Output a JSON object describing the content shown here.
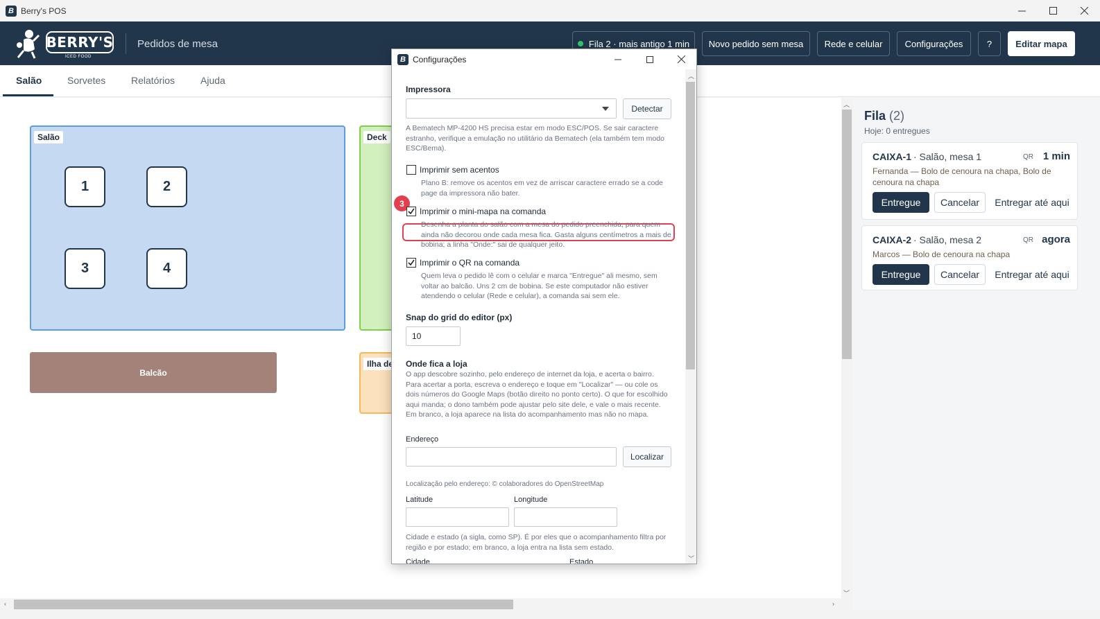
{
  "window": {
    "title": "Berry's POS",
    "app_icon": "berrys-icon",
    "minimize": "—",
    "maximize": "☐",
    "close": "✕"
  },
  "header": {
    "logo_text": "BERRY'S",
    "logo_sub": "ICED FOOD",
    "page_title": "Pedidos de mesa",
    "queue_status": "Fila 2 · mais antigo 1 min",
    "buttons": {
      "new_order": "Novo pedido sem mesa",
      "network": "Rede e celular",
      "settings": "Configurações",
      "help": "?",
      "edit_map": "Editar mapa"
    }
  },
  "tabs": [
    "Salão",
    "Sorvetes",
    "Relatórios",
    "Ajuda"
  ],
  "map": {
    "zones": {
      "salao": "Salão",
      "deck": "Deck",
      "ilha": "Ilha de"
    },
    "tables": [
      "1",
      "2",
      "3",
      "4"
    ],
    "counter": "Balcão"
  },
  "queue": {
    "title": "Fila",
    "count": "(2)",
    "subtitle": "Hoje: 0 entregues",
    "orders": [
      {
        "code": "CAIXA-1",
        "place": "· Salão, mesa 1",
        "qr": "QR",
        "time": "1 min",
        "customer": "Fernanda",
        "items": "— Bolo de cenoura na chapa, Bolo de cenoura na chapa",
        "deliver": "Entregue",
        "cancel": "Cancelar",
        "deliver_here": "Entregar até aqui"
      },
      {
        "code": "CAIXA-2",
        "place": "· Salão, mesa 2",
        "qr": "QR",
        "time": "agora",
        "customer": "Marcos",
        "items": "— Bolo de cenoura na chapa",
        "deliver": "Entregue",
        "cancel": "Cancelar",
        "deliver_here": "Entregar até aqui"
      }
    ]
  },
  "dialog": {
    "title": "Configurações",
    "step_badge": "3",
    "printer": {
      "label": "Impressora",
      "value": "",
      "detect": "Detectar",
      "help": "A Bematech MP-4200 HS precisa estar em modo ESC/POS. Se sair caractere estranho, verifique a emulação no utilitário da Bematech (ela também tem modo ESC/Bema)."
    },
    "no_accents": {
      "label": "Imprimir sem acentos",
      "checked": false,
      "help": "Plano B: remove os acentos em vez de arriscar caractere errado se a code page da impressora não bater."
    },
    "minimap": {
      "label": "Imprimir o mini-mapa na comanda",
      "checked": true,
      "help": "Desenha a planta do salão com a mesa do pedido preenchida, para quem ainda não decorou onde cada mesa fica. Gasta alguns centímetros a mais de bobina; a linha \"Onde:\" sai de qualquer jeito."
    },
    "qr": {
      "label": "Imprimir o QR na comanda",
      "checked": true,
      "help": "Quem leva o pedido lê com o celular e marca \"Entregue\" ali mesmo, sem voltar ao balcão. Uns 2 cm de bobina. Se este computador não estiver atendendo o celular (Rede e celular), a comanda sai sem ele."
    },
    "snap": {
      "label": "Snap do grid do editor (px)",
      "value": "10"
    },
    "location": {
      "heading": "Onde fica a loja",
      "help": "O app descobre sozinho, pelo endereço de internet da loja, e acerta o bairro. Para acertar a porta, escreva o endereço e toque em \"Localizar\" — ou cole os dois números do Google Maps (botão direito no ponto certo). O que for escolhido aqui manda; o dono também pode ajustar pelo site dele, e vale o mais recente. Em branco, a loja aparece na lista do acompanhamento mas não no mapa.",
      "address_label": "Endereço",
      "address_value": "",
      "locate": "Localizar",
      "attribution": "Localização pelo endereço: © colaboradores do OpenStreetMap",
      "lat_label": "Latitude",
      "lat_value": "",
      "lon_label": "Longitude",
      "lon_value": "",
      "city_help": "Cidade e estado (a sigla, como SP). É por eles que o acompanhamento filtra por região e por estado; em branco, a loja entra na lista sem estado.",
      "city_label": "Cidade",
      "state_label": "Estado"
    }
  },
  "colors": {
    "brand": "#22364b",
    "salao_zone": "#c5daf2",
    "deck_zone": "#d2efbe",
    "ilha_zone": "#fbe1bc",
    "counter": "#a38379",
    "highlight": "#e04050",
    "status_ok": "#34c66b"
  }
}
